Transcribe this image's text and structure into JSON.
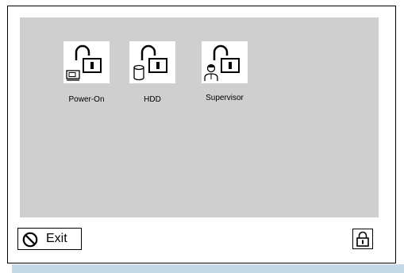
{
  "password_items": [
    {
      "label": "Power-On",
      "icon": "power-on-password-icon"
    },
    {
      "label": "HDD",
      "icon": "hdd-password-icon"
    },
    {
      "label": "Supervisor",
      "icon": "supervisor-password-icon"
    }
  ],
  "footer": {
    "exit_label": "Exit",
    "exit_icon": "no-entry-icon",
    "lock_icon": "padlock-icon"
  },
  "colors": {
    "panel": "#cfcfcf",
    "border": "#000000",
    "strip": "#c5d9e6",
    "background": "#ffffff"
  }
}
